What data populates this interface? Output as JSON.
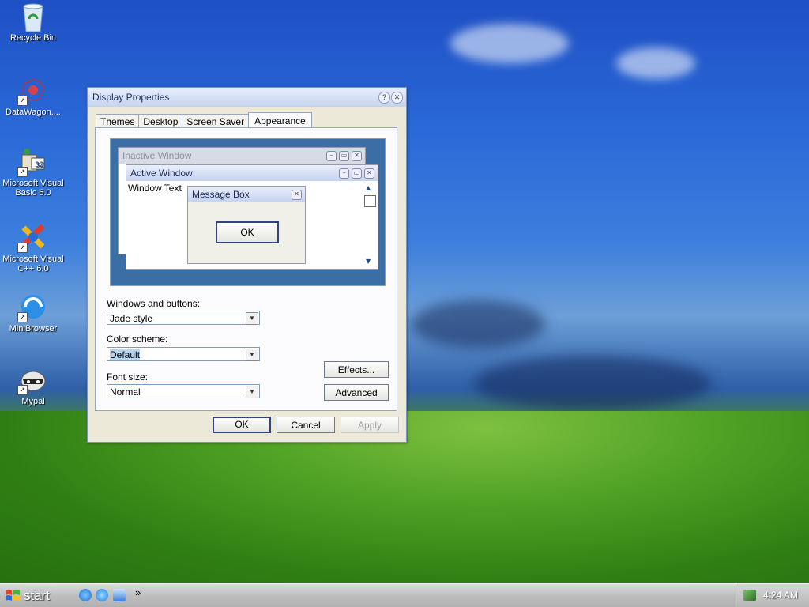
{
  "desktop": {
    "icons": [
      {
        "label": "Recycle Bin",
        "icon": "recycle-bin-icon",
        "shortcut": false
      },
      {
        "label": "DataWagon....",
        "icon": "datawagon-icon",
        "shortcut": true
      },
      {
        "label": "Microsoft Visual Basic 6.0",
        "icon": "visual-basic-icon",
        "shortcut": true
      },
      {
        "label": "Microsoft Visual C++ 6.0",
        "icon": "visual-cpp-icon",
        "shortcut": true
      },
      {
        "label": "MiniBrowser",
        "icon": "minibrowser-icon",
        "shortcut": true
      },
      {
        "label": "Mypal",
        "icon": "mypal-icon",
        "shortcut": true
      }
    ]
  },
  "dialog": {
    "title": "Display Properties",
    "tabs": [
      {
        "label": "Themes",
        "active": false
      },
      {
        "label": "Desktop",
        "active": false
      },
      {
        "label": "Screen Saver",
        "active": false
      },
      {
        "label": "Appearance",
        "active": true
      }
    ],
    "preview": {
      "inactive_title": "Inactive Window",
      "active_title": "Active Window",
      "window_text": "Window Text",
      "message_box_title": "Message Box",
      "ok_label": "OK"
    },
    "windows_and_buttons": {
      "label": "Windows and buttons:",
      "value": "Jade style"
    },
    "color_scheme": {
      "label": "Color scheme:",
      "value": "Default"
    },
    "font_size": {
      "label": "Font size:",
      "value": "Normal"
    },
    "effects_label": "Effects...",
    "advanced_label": "Advanced",
    "ok_label": "OK",
    "cancel_label": "Cancel",
    "apply_label": "Apply"
  },
  "taskbar": {
    "start_label": "start",
    "quick_launch": [
      "internet-explorer-icon",
      "minibrowser-icon",
      "outlook-express-icon"
    ],
    "overflow": "»",
    "clock": "4:24 AM"
  }
}
